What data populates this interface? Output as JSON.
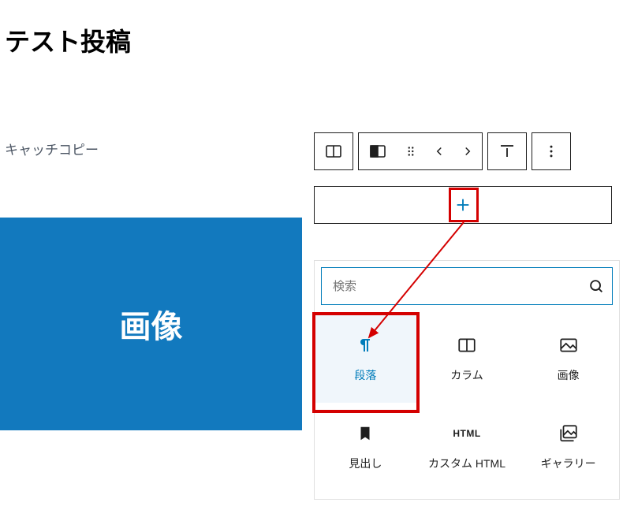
{
  "post": {
    "title": "テスト投稿",
    "catchcopy": "キャッチコピー",
    "image_placeholder": "画像"
  },
  "toolbar": {
    "icons": {
      "columns": "columns-icon",
      "column_variation": "column-variation-icon",
      "drag": "drag-handle-icon",
      "move_up": "chevron-left-icon",
      "move_down": "chevron-right-icon",
      "align": "align-top-icon",
      "more": "more-vertical-icon"
    }
  },
  "appender": {
    "plus": "+"
  },
  "inserter": {
    "search_placeholder": "検索",
    "blocks": [
      {
        "id": "paragraph",
        "label": "段落",
        "icon": "pilcrow-icon",
        "selected": true
      },
      {
        "id": "columns",
        "label": "カラム",
        "icon": "columns-icon",
        "selected": false
      },
      {
        "id": "image",
        "label": "画像",
        "icon": "image-icon",
        "selected": false
      },
      {
        "id": "heading",
        "label": "見出し",
        "icon": "bookmark-icon",
        "selected": false
      },
      {
        "id": "custom_html",
        "label": "カスタム HTML",
        "icon": "html-icon",
        "selected": false
      },
      {
        "id": "gallery",
        "label": "ギャラリー",
        "icon": "gallery-icon",
        "selected": false
      }
    ]
  },
  "annotation": {
    "highlight_color": "#d40000",
    "arrow_from": "plus-button",
    "arrow_to": "paragraph-block"
  }
}
